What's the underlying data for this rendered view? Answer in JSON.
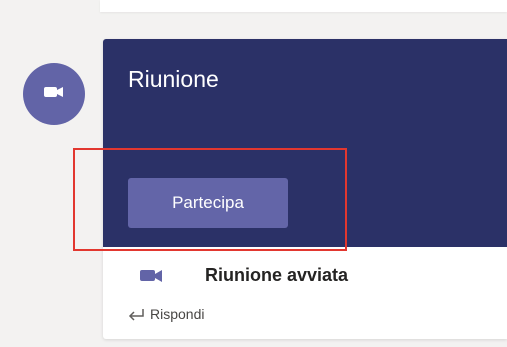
{
  "meeting": {
    "title": "Riunione",
    "join_label": "Partecipa",
    "status_text": "Riunione avviata",
    "reply_label": "Rispondi"
  },
  "icons": {
    "avatar": "video-camera-icon",
    "status": "video-camera-icon",
    "reply": "reply-arrow-icon"
  },
  "colors": {
    "banner": "#2b3167",
    "accent": "#6264a7",
    "highlight": "#e2372f"
  }
}
